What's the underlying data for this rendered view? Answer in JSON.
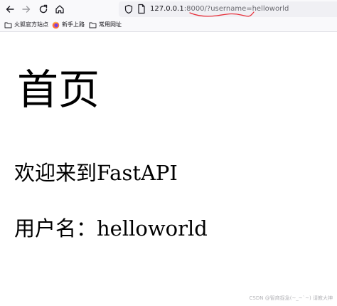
{
  "toolbar": {
    "url_host": "127.0.0.1",
    "url_port": ":8000",
    "url_rest": "/?username=helloworld"
  },
  "bookmarks": [
    {
      "label": "火狐官方站点",
      "icon": "folder-icon"
    },
    {
      "label": "新手上路",
      "icon": "firefox-icon"
    },
    {
      "label": "常用网址",
      "icon": "folder-icon"
    }
  ],
  "page": {
    "heading": "首页",
    "welcome": "欢迎来到FastAPI",
    "username_line": "用户名：helloworld"
  },
  "watermark": "CSDN @智商捉急(~_~`~) 请教大神",
  "colors": {
    "scribble": "#e8303a",
    "firefox_orange": "#ff7139"
  }
}
